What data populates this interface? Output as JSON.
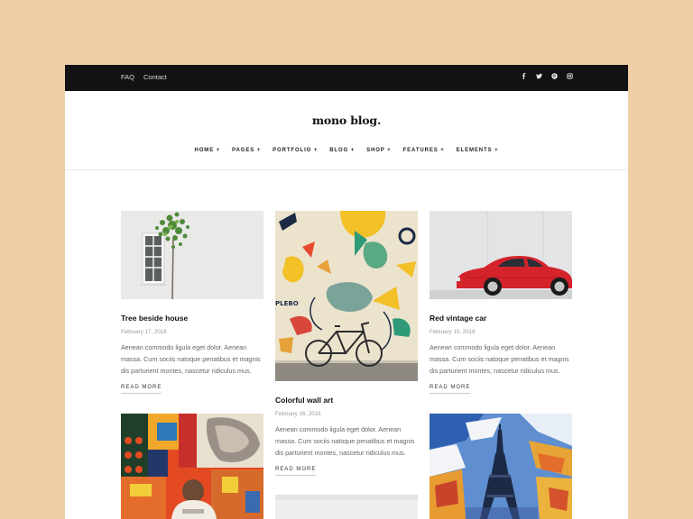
{
  "topbar": {
    "links": [
      "FAQ",
      "Contact"
    ],
    "social": [
      "facebook-icon",
      "twitter-icon",
      "pinterest-icon",
      "instagram-icon"
    ]
  },
  "header": {
    "logo": "mono blog.",
    "nav": [
      "HOME +",
      "PAGES +",
      "PORTFOLIO +",
      "BLOG +",
      "SHOP +",
      "FEATURES +",
      "ELEMENTS +"
    ]
  },
  "posts": [
    {
      "title": "Tree beside house",
      "date": "February 17, 2018",
      "excerpt": "Aenean commodo ligula eget dolor. Aenean massa. Cum sociis natoque penatibus et magnis dis parturient montes, nascetur ridiculus mus.",
      "more": "READ MORE"
    },
    {
      "title": "Colorful wall art",
      "date": "February 16, 2018",
      "excerpt": "Aenean commodo ligula eget dolor. Aenean massa. Cum sociis natoque penatibus et magnis dis parturient montes, nascetur ridiculus mus.",
      "more": "READ MORE"
    },
    {
      "title": "Red vintage car",
      "date": "February 15, 2018",
      "excerpt": "Aenean commodo ligula eget dolor. Aenean massa. Cum sociis natoque penatibus et magnis dis parturient montes, nascetur ridiculus mus.",
      "more": "READ MORE"
    }
  ],
  "colors": {
    "background": "#f0cfa8",
    "topbar": "#121212",
    "accent_red": "#d4232b"
  }
}
